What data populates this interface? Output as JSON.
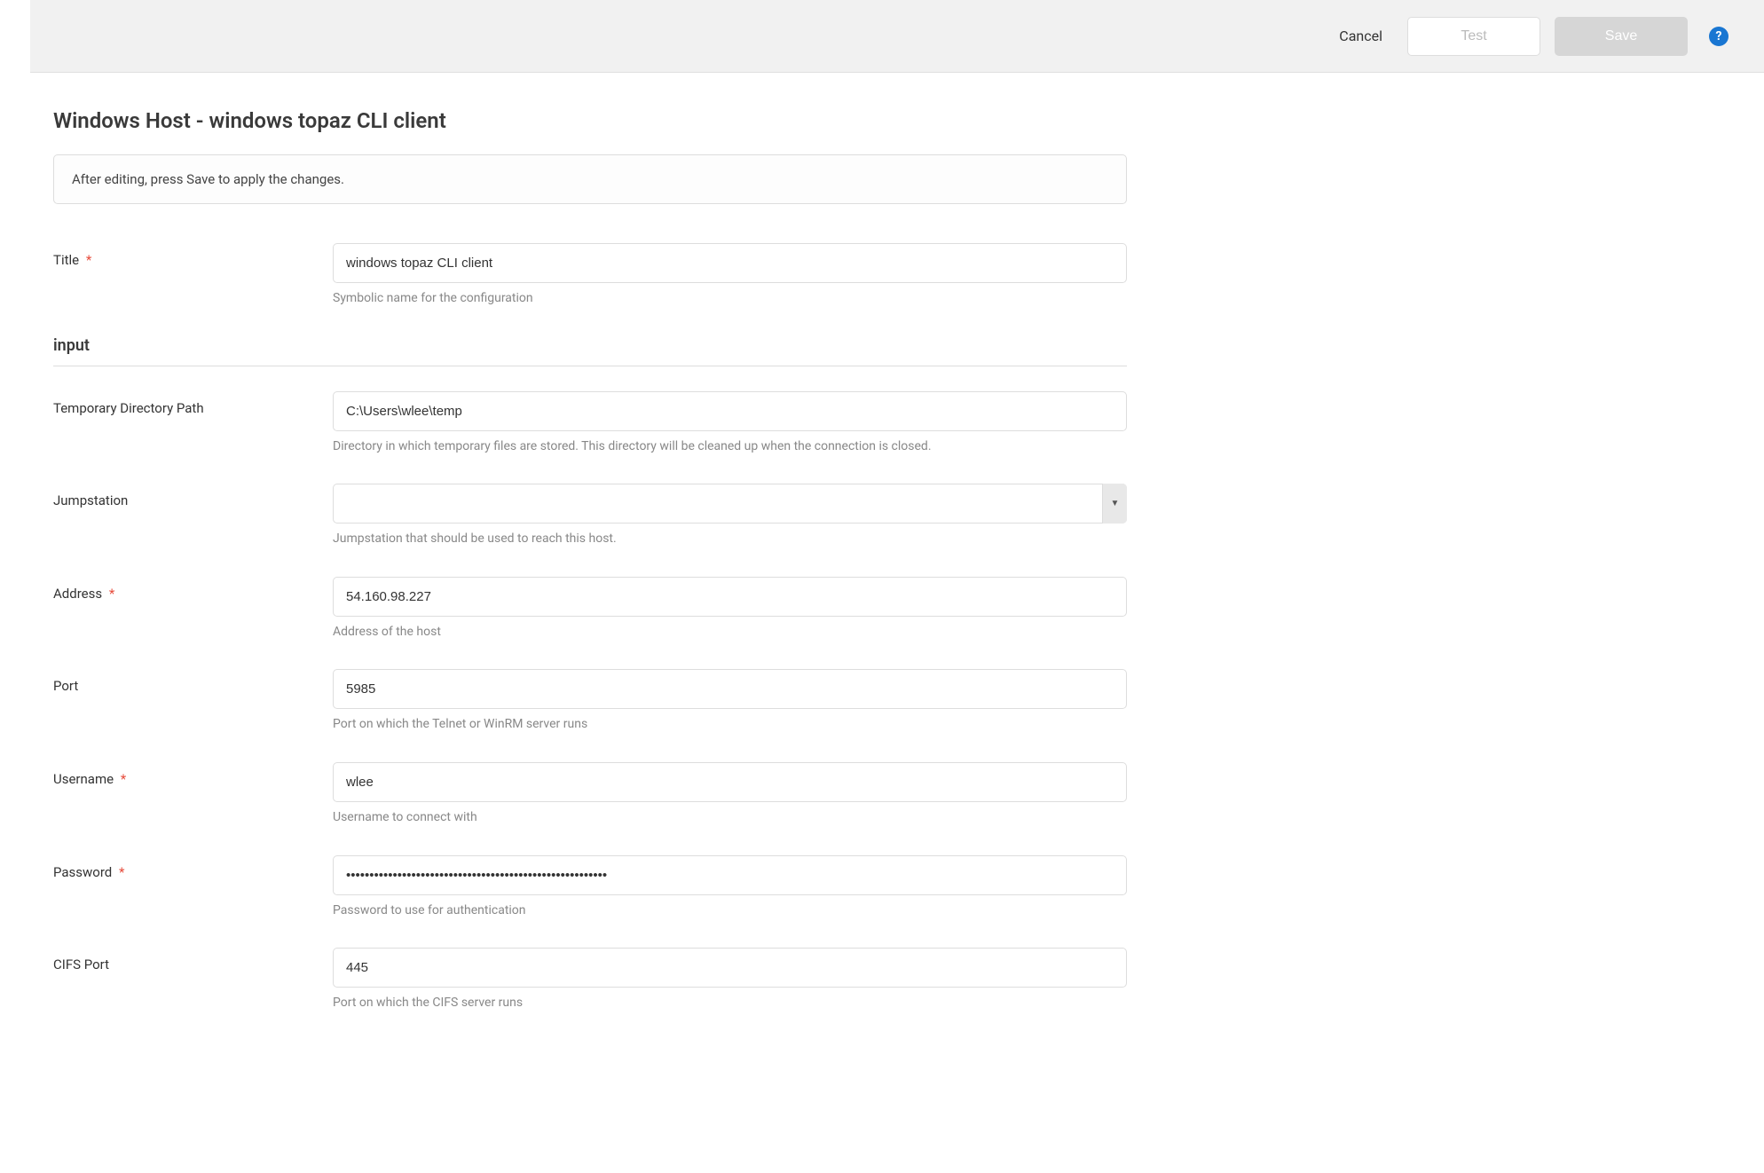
{
  "header": {
    "cancel_label": "Cancel",
    "test_label": "Test",
    "save_label": "Save",
    "help_symbol": "?"
  },
  "page": {
    "title": "Windows Host - windows topaz CLI client",
    "banner": "After editing, press Save to apply the changes."
  },
  "section": {
    "input_label": "input"
  },
  "fields": {
    "title": {
      "label": "Title",
      "value": "windows topaz CLI client",
      "hint": "Symbolic name for the configuration"
    },
    "temp_dir": {
      "label": "Temporary Directory Path",
      "value": "C:\\Users\\wlee\\temp",
      "hint": "Directory in which temporary files are stored. This directory will be cleaned up when the connection is closed."
    },
    "jumpstation": {
      "label": "Jumpstation",
      "value": "",
      "hint": "Jumpstation that should be used to reach this host."
    },
    "address": {
      "label": "Address",
      "value": "54.160.98.227",
      "hint": "Address of the host"
    },
    "port": {
      "label": "Port",
      "value": "5985",
      "hint": "Port on which the Telnet or WinRM server runs"
    },
    "username": {
      "label": "Username",
      "value": "wlee",
      "hint": "Username to connect with"
    },
    "password": {
      "label": "Password",
      "value": "••••••••••••••••••••••••••••••••••••••••••••••••••••••••",
      "hint": "Password to use for authentication"
    },
    "cifs_port": {
      "label": "CIFS Port",
      "value": "445",
      "hint": "Port on which the CIFS server runs"
    }
  },
  "required_marker": "*"
}
